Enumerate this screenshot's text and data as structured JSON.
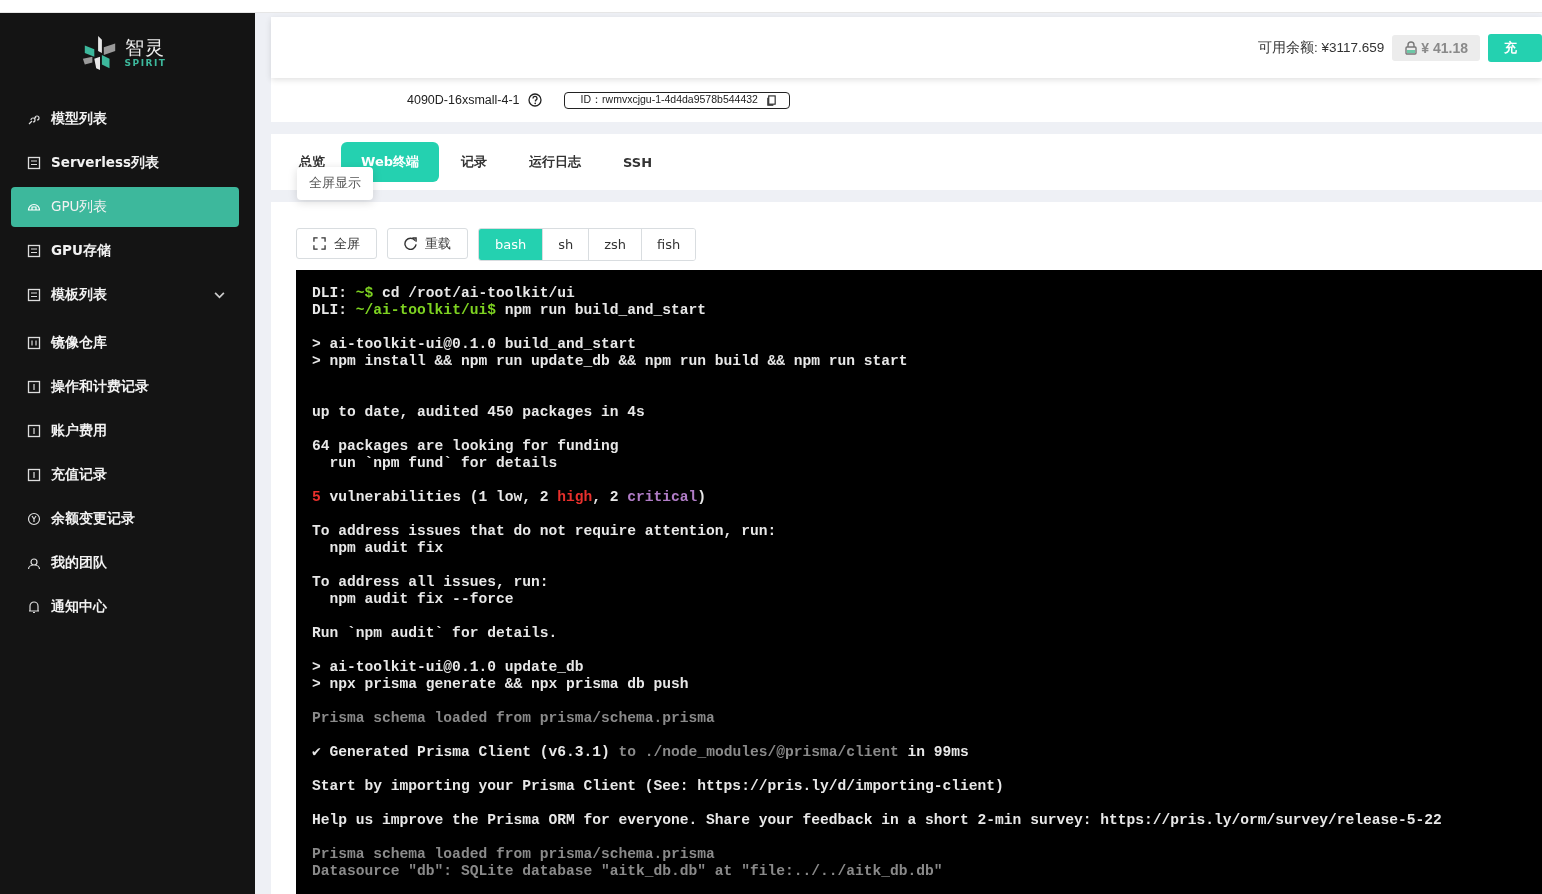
{
  "brand": {
    "name": "智灵",
    "tagline": "SPIRIT"
  },
  "sidebar": {
    "items": [
      {
        "label": "模型列表",
        "selected": false
      },
      {
        "label": "Serverless列表",
        "selected": false
      },
      {
        "label": "GPU列表",
        "selected": true
      },
      {
        "label": "GPU存储",
        "selected": false
      },
      {
        "label": "模板列表",
        "selected": false,
        "expandable": true,
        "expanded": false
      },
      {
        "label": "镜像仓库",
        "selected": false
      },
      {
        "label": "操作和计费记录",
        "selected": false
      },
      {
        "label": "账户费用",
        "selected": false
      },
      {
        "label": "充值记录",
        "selected": false
      },
      {
        "label": "余额变更记录",
        "selected": false
      },
      {
        "label": "我的团队",
        "selected": false
      },
      {
        "label": "通知中心",
        "selected": false
      }
    ]
  },
  "header": {
    "balance": "可用余额: ¥3117.659",
    "locked_amount": "¥ 41.18",
    "recharge_button": "充"
  },
  "instance": {
    "name": "4090D-16xsmall-4-1",
    "id": "ID：rwmvxcjgu-1-4d4da9578b544432"
  },
  "tabs": [
    {
      "label": "总览",
      "selected": false
    },
    {
      "label": "Web终端",
      "selected": true
    },
    {
      "label": "记录",
      "selected": false
    },
    {
      "label": "运行日志",
      "selected": false
    },
    {
      "label": "SSH",
      "selected": false
    }
  ],
  "tooltip": "全屏显示",
  "toolbar": {
    "fullscreen": "全屏",
    "reload": "重载"
  },
  "shells": [
    {
      "label": "bash",
      "selected": true
    },
    {
      "label": "sh",
      "selected": false
    },
    {
      "label": "zsh",
      "selected": false
    },
    {
      "label": "fish",
      "selected": false
    }
  ],
  "terminal": {
    "blocks": [
      {
        "lines": [
          [
            {
              "kind": "plain",
              "text": "DLI: "
            },
            {
              "kind": "green",
              "text": "~$"
            },
            {
              "kind": "plain",
              "text": " cd /root/ai-toolkit/ui"
            }
          ],
          [
            {
              "kind": "plain",
              "text": "DLI: "
            },
            {
              "kind": "green",
              "text": "~/ai-toolkit/ui$"
            },
            {
              "kind": "plain",
              "text": " npm run build_and_start"
            }
          ]
        ]
      },
      {
        "lines": [
          [
            {
              "kind": "plain",
              "text": "> ai-toolkit-ui@0.1.0 build_and_start"
            }
          ],
          [
            {
              "kind": "plain",
              "text": "> npm install && npm run update_db && npm run build && npm run start"
            }
          ]
        ]
      },
      {
        "extra_space": true,
        "lines": [
          [
            {
              "kind": "plain",
              "text": "up to date, audited 450 packages in 4s"
            }
          ]
        ]
      },
      {
        "lines": [
          [
            {
              "kind": "plain",
              "text": "64 packages are looking for funding"
            }
          ],
          [
            {
              "kind": "plain",
              "text": "  run `npm fund` for details"
            }
          ]
        ]
      },
      {
        "lines": [
          [
            {
              "kind": "red",
              "text": "5"
            },
            {
              "kind": "plain",
              "text": " vulnerabilities (1 low, 2 "
            },
            {
              "kind": "red",
              "text": "high"
            },
            {
              "kind": "plain",
              "text": ", 2 "
            },
            {
              "kind": "purple",
              "text": "critical"
            },
            {
              "kind": "plain",
              "text": ")"
            }
          ]
        ]
      },
      {
        "lines": [
          [
            {
              "kind": "plain",
              "text": "To address issues that do not require attention, run:"
            }
          ],
          [
            {
              "kind": "plain",
              "text": "  npm audit fix"
            }
          ]
        ]
      },
      {
        "lines": [
          [
            {
              "kind": "plain",
              "text": "To address all issues, run:"
            }
          ],
          [
            {
              "kind": "plain",
              "text": "  npm audit fix --force"
            }
          ]
        ]
      },
      {
        "lines": [
          [
            {
              "kind": "plain",
              "text": "Run `npm audit` for details."
            }
          ]
        ]
      },
      {
        "lines": [
          [
            {
              "kind": "plain",
              "text": "> ai-toolkit-ui@0.1.0 update_db"
            }
          ],
          [
            {
              "kind": "plain",
              "text": "> npx prisma generate && npx prisma db push"
            }
          ]
        ]
      },
      {
        "lines": [
          [
            {
              "kind": "dim",
              "text": "Prisma schema loaded from prisma/schema.prisma"
            }
          ]
        ]
      },
      {
        "lines": [
          [
            {
              "kind": "plain",
              "text": "✔ Generated Prisma Client (v6.3.1) "
            },
            {
              "kind": "dim",
              "text": "to ./node_modules/@prisma/client"
            },
            {
              "kind": "plain",
              "text": " in 99ms"
            }
          ]
        ]
      },
      {
        "lines": [
          [
            {
              "kind": "plain",
              "text": "Start by importing your Prisma Client (See: https://pris.ly/d/importing-client)"
            }
          ]
        ]
      },
      {
        "lines": [
          [
            {
              "kind": "plain",
              "text": "Help us improve the Prisma ORM for everyone. Share your feedback in a short 2-min survey: https://pris.ly/orm/survey/release-5-22"
            }
          ]
        ]
      },
      {
        "lines": [
          [
            {
              "kind": "dim",
              "text": "Prisma schema loaded from prisma/schema.prisma"
            }
          ],
          [
            {
              "kind": "dim",
              "text": "Datasource \"db\": SQLite database \"aitk_db.db\" at \"file:../../aitk_db.db\""
            }
          ]
        ]
      }
    ]
  }
}
